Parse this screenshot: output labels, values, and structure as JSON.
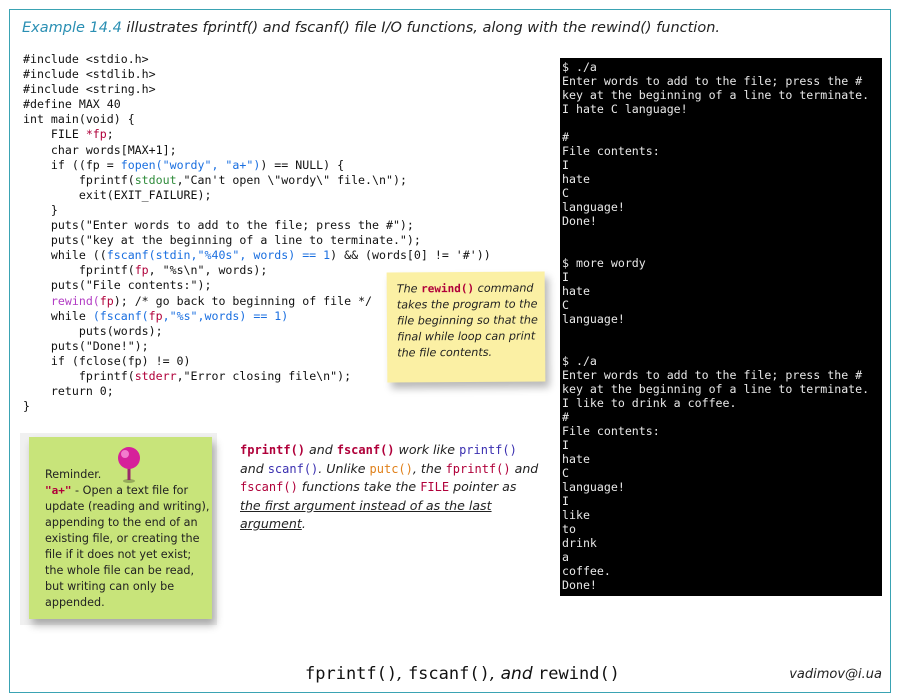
{
  "heading": {
    "example": "Example 14.4",
    "text": " illustrates fprintf() and fscanf() file I/O functions, along with the rewind() function."
  },
  "code_lines": [
    [
      {
        "t": "#include <stdio.h>"
      }
    ],
    [
      {
        "t": "#include <stdlib.h>"
      }
    ],
    [
      {
        "t": "#include <string.h>"
      }
    ],
    [
      {
        "t": "#define MAX 40"
      }
    ],
    [
      {
        "t": "int main(void) {"
      }
    ],
    [
      {
        "t": "    FILE "
      },
      {
        "t": "*fp",
        "c": "r"
      },
      {
        "t": ";"
      }
    ],
    [
      {
        "t": "    char words[MAX+1];"
      }
    ],
    [
      {
        "t": "    if ((fp = "
      },
      {
        "t": "fopen(\"wordy\", \"a+\")",
        "c": "b"
      },
      {
        "t": ") == NULL) {"
      }
    ],
    [
      {
        "t": "        fprintf("
      },
      {
        "t": "stdout",
        "c": "g"
      },
      {
        "t": ",\"Can't open \\\"wordy\\\" file.\\n\");"
      }
    ],
    [
      {
        "t": "        exit(EXIT_FAILURE);"
      }
    ],
    [
      {
        "t": "    }"
      }
    ],
    [
      {
        "t": "    puts(\"Enter words to add to the file; press the #\");"
      }
    ],
    [
      {
        "t": "    puts(\"key at the beginning of a line to terminate.\");"
      }
    ],
    [
      {
        "t": "    while (("
      },
      {
        "t": "fscanf(stdin,\"%40s\", words) == 1",
        "c": "b"
      },
      {
        "t": ") && (words[0] != '#'))"
      }
    ],
    [
      {
        "t": "        fprintf("
      },
      {
        "t": "fp",
        "c": "r"
      },
      {
        "t": ", \"%s\\n\", words);"
      }
    ],
    [
      {
        "t": "    puts(\"File contents:\");"
      }
    ],
    [
      {
        "t": "    "
      },
      {
        "t": "rewind(",
        "c": "m"
      },
      {
        "t": "fp",
        "c": "r"
      },
      {
        "t": "); /* go back to beginning of file */"
      }
    ],
    [
      {
        "t": "    while "
      },
      {
        "t": "(fscanf(",
        "c": "b"
      },
      {
        "t": "fp",
        "c": "r"
      },
      {
        "t": ",\"%s\",words) == 1)",
        "c": "b"
      }
    ],
    [
      {
        "t": "        puts(words);"
      }
    ],
    [
      {
        "t": "    puts(\"Done!\");"
      }
    ],
    [
      {
        "t": "    if (fclose(fp) != 0)"
      }
    ],
    [
      {
        "t": "        fprintf("
      },
      {
        "t": "stderr",
        "c": "r"
      },
      {
        "t": ",\"Error closing file\\n\");"
      }
    ],
    [
      {
        "t": "    return 0;"
      }
    ],
    [
      {
        "t": "}"
      }
    ]
  ],
  "terminal_lines": [
    "$ ./a",
    "Enter words to add to the file; press the #",
    "key at the beginning of a line to terminate.",
    "I hate C language!",
    "",
    "#",
    "File contents:",
    "I",
    "hate",
    "C",
    "language!",
    "Done!",
    "",
    "",
    "$ more wordy",
    "I",
    "hate",
    "C",
    "language!",
    "",
    "",
    "$ ./a",
    "Enter words to add to the file; press the #",
    "key at the beginning of a line to terminate.",
    "I like to drink a coffee.",
    "#",
    "File contents:",
    "I",
    "hate",
    "C",
    "language!",
    "I",
    "like",
    "to",
    "drink",
    "a",
    "coffee.",
    "Done!"
  ],
  "note_yellow": {
    "pre": "The ",
    "keyword": "rewind()",
    "post": " command takes the program to the file beginning so that the final while loop can print the file contents."
  },
  "note_green": {
    "title": "Reminder.",
    "keyword": "\"a+\"",
    "text": " - Open a text file for update (reading and writing), appending to the end of an existing file, or creating the file if it does not yet exist; the whole file can be read, but writing can only be appended."
  },
  "description": {
    "fprintf": "fprintf()",
    "and1": " and ",
    "fscanf": "fscanf()",
    "work_like": " work like ",
    "printf": "printf()",
    "and2": " and ",
    "scanf": "scanf()",
    "unlike": ". Unlike ",
    "putc": "putc()",
    "the": ", the ",
    "fprintf2": "fprintf()",
    "and3": " and ",
    "fscanf2": "fscanf()",
    "functions_take": "  functions take the ",
    "file": "FILE",
    "pointer_as": " pointer as ",
    "underlined": "the first argument instead of as the last argument",
    "end": "."
  },
  "footer": {
    "f1": "fprintf()",
    "sep1": ", ",
    "f2": "fscanf()",
    "sep2": ", and ",
    "f3": "rewind()"
  },
  "author": "vadimov@i.ua",
  "colors": {
    "accent_border": "#3aa3b3",
    "keyword_red": "#b0003a",
    "keyword_blue": "#1a6fe0",
    "keyword_green": "#2e8b3a",
    "keyword_magenta": "#b23cc4",
    "note_yellow": "#fbf0a4",
    "note_green": "#c8e47a",
    "terminal_bg": "#000000"
  }
}
